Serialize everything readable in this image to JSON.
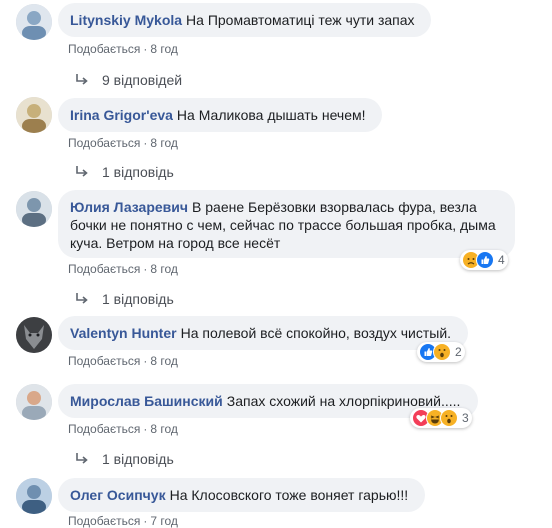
{
  "comments": [
    {
      "author": "Litynskiy Mykola",
      "text": "На Промавтоматиці теж чути запах",
      "like_label": "Подобається",
      "time": "8 год",
      "replies": "9 відповідей",
      "avatar_color": "#8aa7c4"
    },
    {
      "author": "Irina Grigor'eva",
      "text": "На Маликова дышать нечем!",
      "like_label": "Подобається",
      "time": "8 год",
      "replies": "1 відповідь",
      "avatar_color": "#c7b07a"
    },
    {
      "author": "Юлия Лазаревич",
      "text": "В раене Берёзовки взорвалась фура, везла бочки не понятно с чем, сейчас по трассе большая пробка, дыма куча. Ветром на город все несёт",
      "like_label": "Подобається",
      "time": "8 год",
      "replies": "1 відповідь",
      "reactions": [
        "sad",
        "like"
      ],
      "reaction_count": "4",
      "avatar_color": "#7d96ad"
    },
    {
      "author": "Valentyn Hunter",
      "text": "На полевой всё спокойно, воздух чистый.",
      "like_label": "Подобається",
      "time": "8 год",
      "replies": "",
      "reactions": [
        "like",
        "wow"
      ],
      "reaction_count": "2",
      "avatar_color": "#5f6266"
    },
    {
      "author": "Мирослав Башинский",
      "text": "Запах схожий на хлорпікриновий.....",
      "like_label": "Подобається",
      "time": "8 год",
      "replies": "1 відповідь",
      "reactions": [
        "love",
        "haha",
        "wow"
      ],
      "reaction_count": "3",
      "avatar_color": "#9aa9b8"
    },
    {
      "author": "Олег Осипчук",
      "text": "На Клосовского тоже воняет гарью!!!",
      "like_label": "Подобається",
      "time": "7 год",
      "replies": "",
      "avatar_color": "#6f8fb0"
    }
  ],
  "colors": {
    "author": "#385898",
    "bubble": "#f0f2f5",
    "meta": "#606770",
    "like_reaction": "#1877f2",
    "yellow_reaction": "#f7b125",
    "love_reaction": "#f33e58"
  },
  "icons": {
    "reply_arrow": "reply-arrow-icon"
  }
}
